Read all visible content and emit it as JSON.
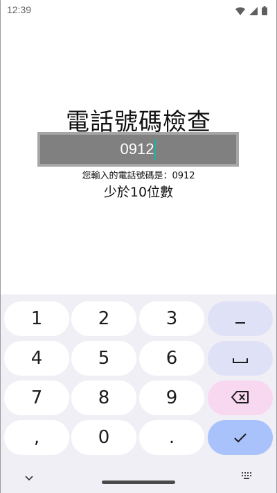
{
  "status_bar": {
    "time": "12:39"
  },
  "page": {
    "title": "電話號碼檢查",
    "phone_input": "0912",
    "info_text": "您輸入的電話號碼是：0912",
    "result_text": "少於10位數"
  },
  "keyboard": {
    "rows": [
      [
        "1",
        "2",
        "3",
        "−"
      ],
      [
        "4",
        "5",
        "6",
        "␣"
      ],
      [
        "7",
        "8",
        "9",
        "⌫"
      ],
      [
        ",",
        "0",
        ".",
        "✓"
      ]
    ]
  },
  "colors": {
    "caret": "#19b3a6",
    "key_function": "#dfe1f7",
    "key_delete": "#f8d8f0",
    "key_done": "#a9c2fb",
    "keyboard_bg": "#f1eff6"
  }
}
